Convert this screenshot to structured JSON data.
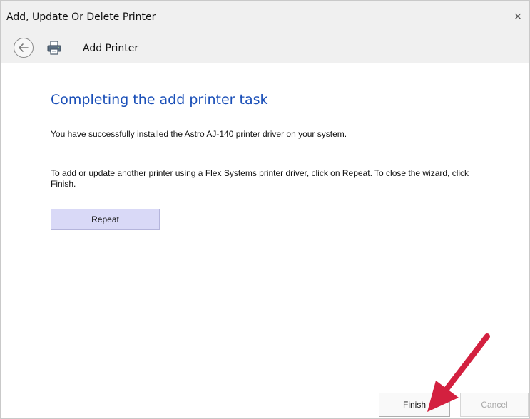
{
  "window": {
    "title": "Add, Update Or Delete Printer",
    "close_glyph": "×"
  },
  "nav": {
    "back_icon": "back-arrow-icon",
    "page_icon": "printer-icon",
    "title": "Add Printer"
  },
  "content": {
    "heading": "Completing the add printer task",
    "message": "You have successfully installed the Astro AJ-140 printer driver on your system.",
    "instructions": "To add or update another printer using a Flex Systems printer driver, click on Repeat. To close the wizard, click Finish.",
    "repeat_label": "Repeat",
    "heading_color": "#1a4fb8"
  },
  "footer": {
    "finish_label": "Finish",
    "cancel_label": "Cancel",
    "cancel_enabled": false
  },
  "annotation": {
    "arrow_color": "#d3203f"
  }
}
